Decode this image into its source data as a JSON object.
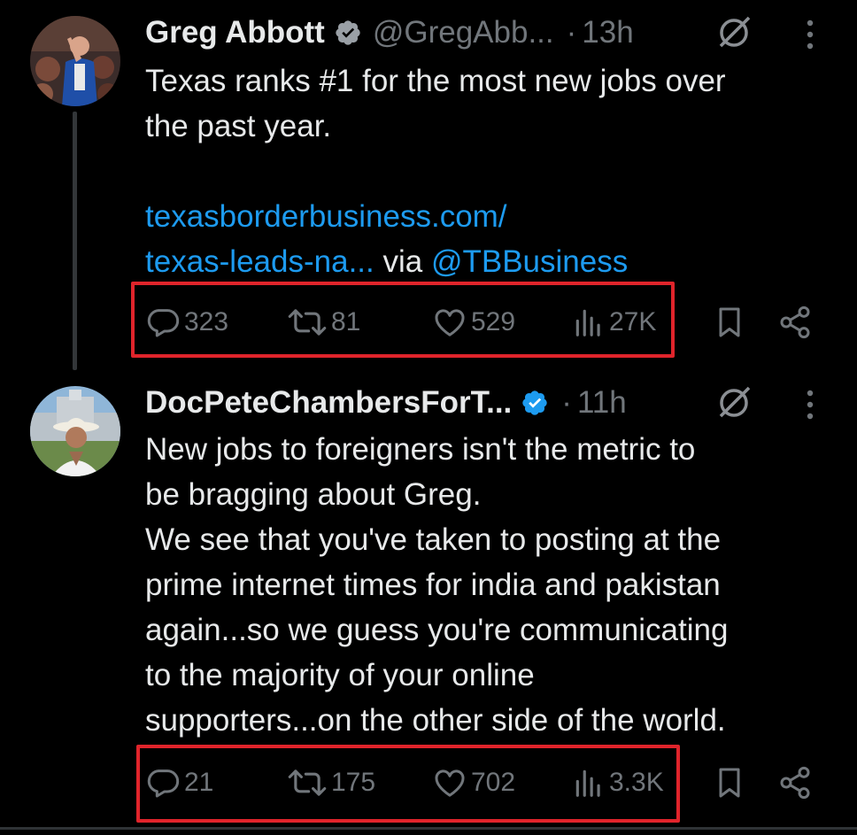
{
  "tweets": [
    {
      "author_name": "Greg Abbott",
      "handle": "@GregAbb...",
      "time": "13h",
      "lines": [
        {
          "text": "Texas ranks #1 for the most new jobs over"
        },
        {
          "text": "the past year."
        },
        {
          "text": ""
        },
        {
          "link": "texasborderbusiness.com/"
        },
        {
          "link": "texas-leads-na...",
          "text": " via ",
          "mention": "@TBBusiness"
        }
      ],
      "stats": {
        "replies": "323",
        "reposts": "81",
        "likes": "529",
        "views": "27K"
      }
    },
    {
      "author_name": "DocPeteChambersForT...",
      "handle": "",
      "time": "11h",
      "lines": [
        {
          "text": "New jobs to foreigners isn't the metric to"
        },
        {
          "text": "be bragging about Greg."
        },
        {
          "text": "We see that you've taken to posting at the"
        },
        {
          "text": "prime internet times for india and pakistan"
        },
        {
          "text": "again...so we guess you're communicating"
        },
        {
          "text": "to the majority of your online"
        },
        {
          "text": "supporters...on the other side of the world."
        }
      ],
      "stats": {
        "replies": "21",
        "reposts": "175",
        "likes": "702",
        "views": "3.3K"
      }
    }
  ],
  "icons": [
    "verified-badge-icon",
    "grok-icon",
    "more-icon",
    "reply-icon",
    "repost-icon",
    "like-icon",
    "views-icon",
    "bookmark-icon",
    "share-icon"
  ],
  "colors": {
    "background": "#000000",
    "text": "#e7e9ea",
    "muted": "#71767b",
    "link": "#1d9bf0",
    "highlight": "#e0242b"
  }
}
